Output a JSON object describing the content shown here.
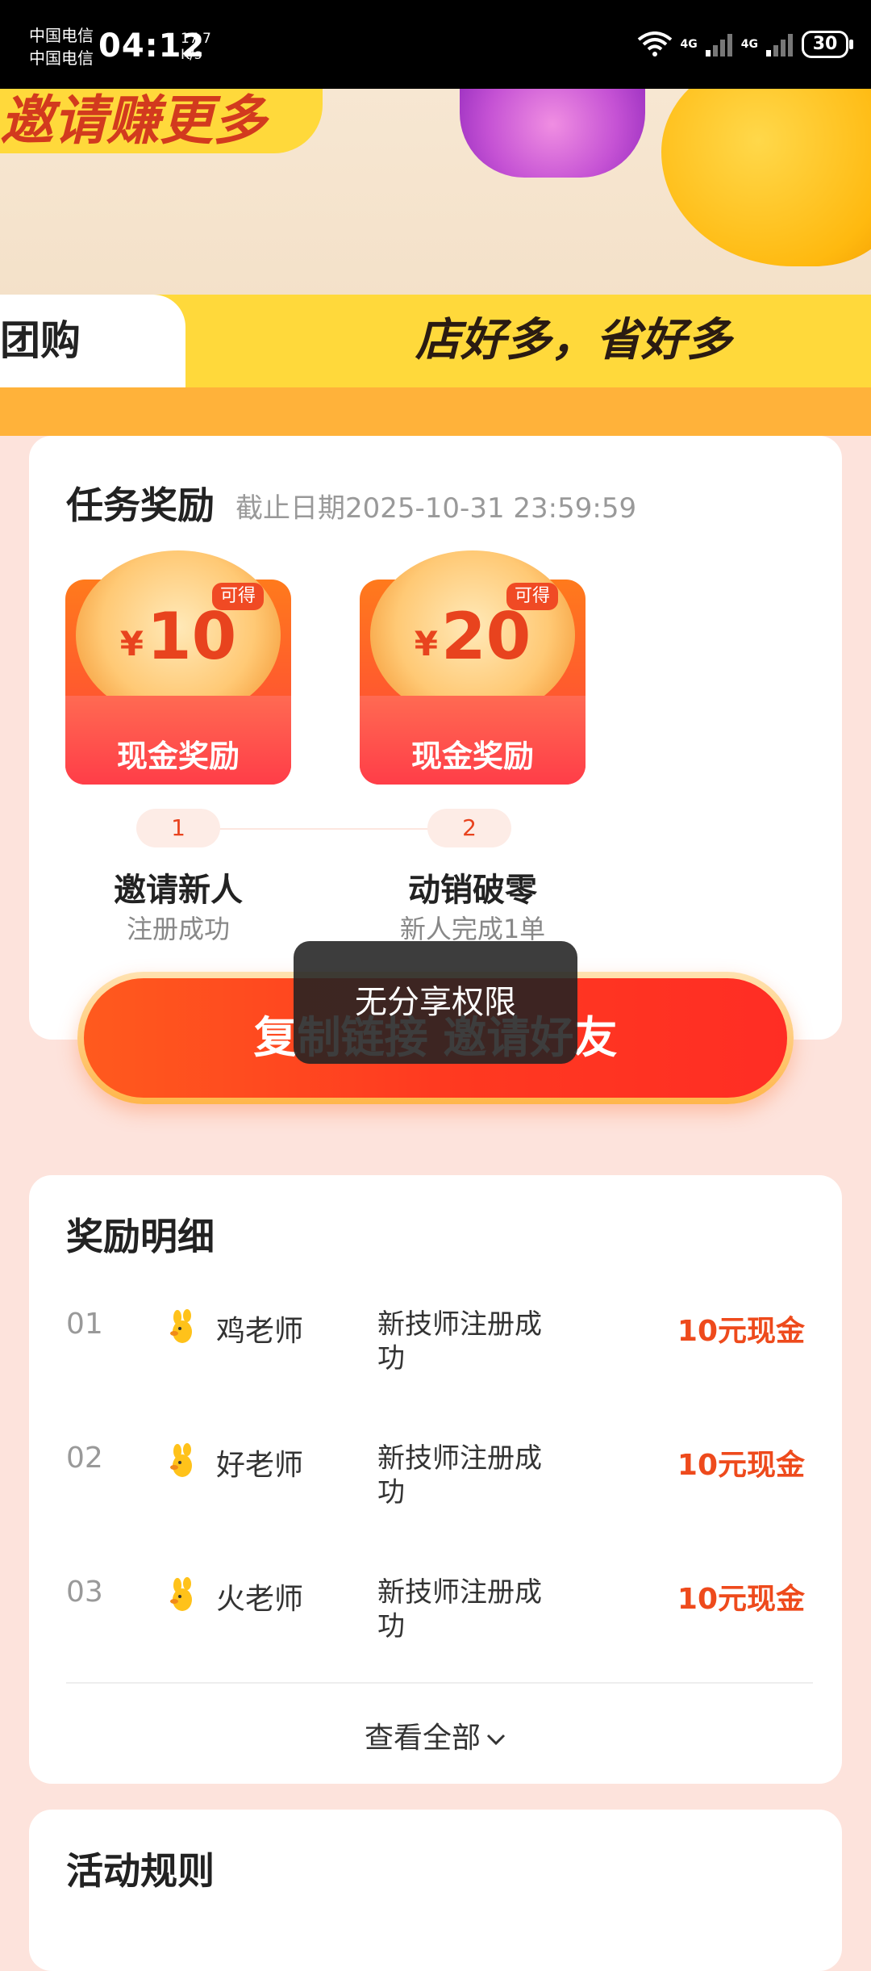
{
  "status_bar": {
    "carrier1": "中国电信",
    "carrier2": "中国电信",
    "time": "04:12",
    "net_speed_value": "17.7",
    "net_speed_unit": "K/s",
    "signal1": "4G",
    "signal2": "4G",
    "battery": "30"
  },
  "banner": {
    "headline": "邀请赚更多",
    "tab_label": "团购",
    "slogan": "店好多，省好多"
  },
  "task": {
    "title": "任务奖励",
    "deadline": "截止日期2025-10-31 23:59:59",
    "rewards": [
      {
        "currency": "¥",
        "amount": "10",
        "badge": "可得",
        "label": "现金奖励",
        "step": "1",
        "step_title": "邀请新人",
        "step_sub": "注册成功"
      },
      {
        "currency": "¥",
        "amount": "20",
        "badge": "可得",
        "label": "现金奖励",
        "step": "2",
        "step_title": "动销破零",
        "step_sub": "新人完成1单"
      }
    ],
    "cta_label": "复制链接 邀请好友"
  },
  "toast": "无分享权限",
  "details": {
    "title": "奖励明细",
    "rows": [
      {
        "idx": "01",
        "name": "鸡老师",
        "desc": "新技师注册成功",
        "amount": "10元现金"
      },
      {
        "idx": "02",
        "name": "好老师",
        "desc": "新技师注册成功",
        "amount": "10元现金"
      },
      {
        "idx": "03",
        "name": "火老师",
        "desc": "新技师注册成功",
        "amount": "10元现金"
      }
    ],
    "view_all": "查看全部"
  },
  "rules": {
    "title": "活动规则"
  },
  "colors": {
    "accent": "#ee4a1c",
    "page_bg": "#fde3dc",
    "banner_yellow": "#ffd93b"
  }
}
